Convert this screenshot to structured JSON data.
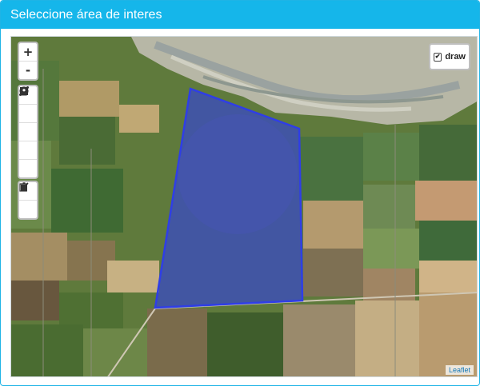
{
  "header": {
    "title": "Seleccione área de interes"
  },
  "map": {
    "zoom_in_label": "+",
    "zoom_out_label": "-",
    "draw_tools": [
      {
        "name": "draw-polyline-tool",
        "icon": "polyline-icon"
      },
      {
        "name": "draw-polygon-tool",
        "icon": "pentagon-icon"
      },
      {
        "name": "draw-rectangle-tool",
        "icon": "square-icon"
      },
      {
        "name": "draw-circle-tool",
        "icon": "circle-icon"
      },
      {
        "name": "draw-marker-tool",
        "icon": "marker-icon"
      }
    ],
    "edit_tools": [
      {
        "name": "edit-layers-tool",
        "icon": "edit-icon"
      },
      {
        "name": "delete-layers-tool",
        "icon": "trash-icon"
      }
    ],
    "layer_control": {
      "label": "draw",
      "checked": true,
      "check_glyph": "✔"
    },
    "attribution": "Leaflet",
    "polygon_color": "#2f3ee6"
  }
}
